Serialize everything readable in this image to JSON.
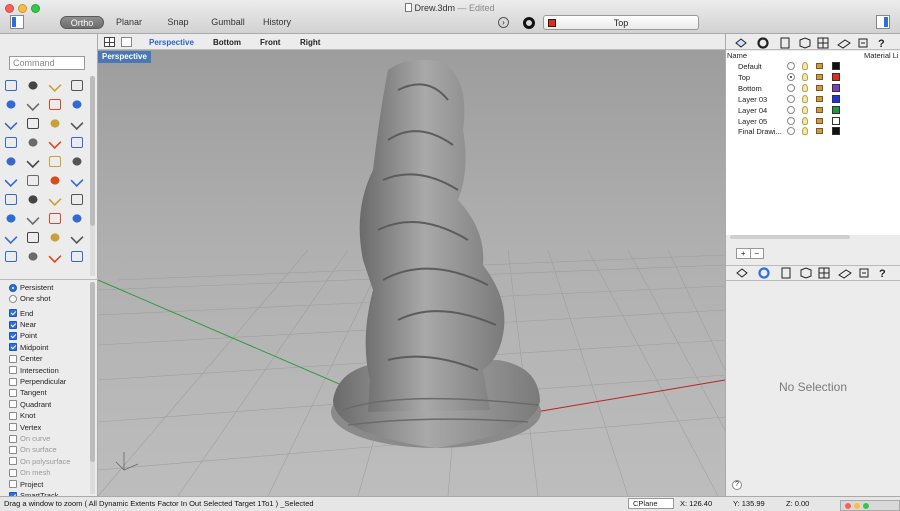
{
  "window": {
    "title": "Drew.3dm",
    "edited": "— Edited"
  },
  "toolbar": {
    "ortho": "Ortho",
    "planar": "Planar",
    "snap": "Snap",
    "gumball": "Gumball",
    "history": "History",
    "current_layer": "Top",
    "current_layer_color": "#e02a1b"
  },
  "view_tabs": [
    "Perspective",
    "Bottom",
    "Front",
    "Right"
  ],
  "viewport_label": "Perspective",
  "command": {
    "placeholder": "Command"
  },
  "tool_icons": [
    "select-arrow-icon",
    "point-icon",
    "polyline-icon",
    "line-icon",
    "circle-icon",
    "arc-icon",
    "rectangle-icon",
    "polygon-icon",
    "ellipse-icon",
    "curve-icon",
    "extrude-icon",
    "surface-icon",
    "box-icon",
    "sphere-icon",
    "cylinder-icon",
    "mesh-icon",
    "boolean-icon",
    "fillet-icon",
    "split-icon",
    "trim-icon",
    "join-icon",
    "move-icon",
    "rotate-icon",
    "scale-icon",
    "dimension-icon",
    "text-icon",
    "array-icon",
    "mirror-icon",
    "grid-icon",
    "array-grid-icon",
    "sweep-icon",
    "analyze-icon",
    "layer-icon",
    "check-icon",
    "blend-icon",
    "paint-icon",
    "zoom-icon",
    "render-icon",
    "camera-icon",
    "light-icon"
  ],
  "snaps": {
    "modes": [
      {
        "label": "Persistent",
        "on": true
      },
      {
        "label": "One shot",
        "on": false
      }
    ],
    "items": [
      {
        "label": "End",
        "on": true,
        "dim": false
      },
      {
        "label": "Near",
        "on": true,
        "dim": false
      },
      {
        "label": "Point",
        "on": true,
        "dim": false
      },
      {
        "label": "Midpoint",
        "on": true,
        "dim": false
      },
      {
        "label": "Center",
        "on": false,
        "dim": false
      },
      {
        "label": "Intersection",
        "on": false,
        "dim": false
      },
      {
        "label": "Perpendicular",
        "on": false,
        "dim": false
      },
      {
        "label": "Tangent",
        "on": false,
        "dim": false
      },
      {
        "label": "Quadrant",
        "on": false,
        "dim": false
      },
      {
        "label": "Knot",
        "on": false,
        "dim": false
      },
      {
        "label": "Vertex",
        "on": false,
        "dim": false
      },
      {
        "label": "On curve",
        "on": false,
        "dim": true
      },
      {
        "label": "On surface",
        "on": false,
        "dim": true
      },
      {
        "label": "On polysurface",
        "on": false,
        "dim": true
      },
      {
        "label": "On mesh",
        "on": false,
        "dim": true
      },
      {
        "label": "Project",
        "on": false,
        "dim": false
      },
      {
        "label": "SmartTrack",
        "on": true,
        "dim": false
      }
    ]
  },
  "layers": {
    "headers": {
      "name": "Name",
      "material": "Material Li"
    },
    "rows": [
      {
        "name": "Default",
        "current": false,
        "color": "#111111"
      },
      {
        "name": "Top",
        "current": true,
        "color": "#e02a1b"
      },
      {
        "name": "Bottom",
        "current": false,
        "color": "#7b3fc6"
      },
      {
        "name": "Layer 03",
        "current": false,
        "color": "#2233dd"
      },
      {
        "name": "Layer 04",
        "current": false,
        "color": "#1f9a3a"
      },
      {
        "name": "Layer 05",
        "current": false,
        "color": "#ffffff"
      },
      {
        "name": "Final Drawi...",
        "current": false,
        "color": "#111111"
      }
    ],
    "add": "+",
    "remove": "−"
  },
  "properties": {
    "empty_text": "No Selection",
    "help": "?"
  },
  "status": {
    "prompt": "Drag a window to zoom ( All Dynamic Extents Factor In Out Selected Target 1To1 ) _Selected",
    "cplane": "CPlane",
    "x": "X: 126.40",
    "y": "Y: 135.99",
    "z": "Z: 0.00"
  }
}
